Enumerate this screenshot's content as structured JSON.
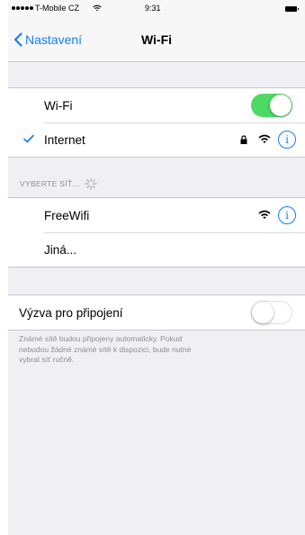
{
  "status_bar": {
    "carrier": "T-Mobile CZ",
    "time": "9:31",
    "signal_dots": 5,
    "icons": [
      "wifi-icon",
      "battery-icon"
    ]
  },
  "nav": {
    "back_label": "Nastavení",
    "title": "Wi-Fi"
  },
  "wifi_group": {
    "toggle_label": "Wi-Fi",
    "toggle_on": true,
    "connected_network": "Internet",
    "connected_icons": [
      "checkmark-icon",
      "lock-icon",
      "wifi-icon",
      "info-icon"
    ]
  },
  "networks_section": {
    "header": "VYBERTE SÍŤ...",
    "items": [
      {
        "name": "FreeWifi",
        "icons": [
          "wifi-icon",
          "info-icon"
        ]
      },
      {
        "name": "Jiná..."
      }
    ]
  },
  "prompt_group": {
    "label": "Výzva pro připojení",
    "toggle_on": false,
    "footer_lines": [
      "Známé sítě budou připojeny automaticky. Pokud",
      "nebudou žádné známé sítě k dispozici, bude nutné",
      "vybrat síť ručně."
    ]
  },
  "colors": {
    "accent": "#147efb",
    "toggle_on": "#4cd964",
    "background": "#efeff4",
    "secondary_text": "#8e8e93"
  }
}
